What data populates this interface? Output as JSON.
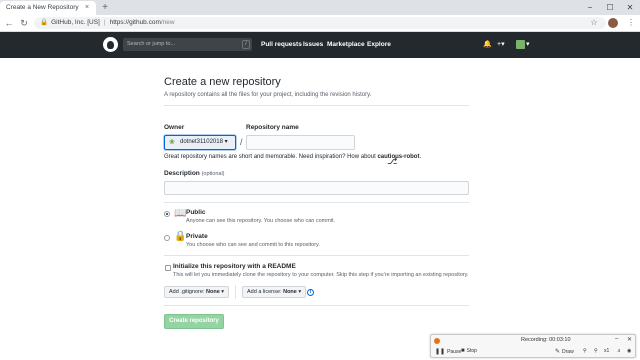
{
  "browser": {
    "tab_title": "Create a New Repository",
    "tab_close": "×",
    "new_tab": "+",
    "window_controls": {
      "minimize": "−",
      "maximize": "☐",
      "close": "✕"
    },
    "site_identity": "GitHub, Inc. [US]",
    "url_host": "https://github.com",
    "url_path": "/new"
  },
  "github_header": {
    "search_placeholder": "Search or jump to...",
    "search_key": "/",
    "nav": [
      "Pull requests",
      "Issues",
      "Marketplace",
      "Explore"
    ],
    "icons": [
      "bell-icon",
      "plus-icon",
      "avatar"
    ]
  },
  "form": {
    "title": "Create a new repository",
    "subtitle": "A repository contains all the files for your project, including the revision history.",
    "owner_label": "Owner",
    "owner_value": "dotnet31102018",
    "repo_name_label": "Repository name",
    "repo_name_value": "",
    "slash": "/",
    "hint_prefix": "Great repository names are short and memorable. Need inspiration? How about ",
    "hint_suggestion": "cautious-robot",
    "hint_suffix": ".",
    "description_label": "Description",
    "description_optional": "(optional)",
    "description_value": "",
    "public_title": "Public",
    "public_desc": "Anyone can see this repository. You choose who can commit.",
    "private_title": "Private",
    "private_desc": "You choose who can see and commit to this repository.",
    "visibility_selected": "Public",
    "readme_title": "Initialize this repository with a README",
    "readme_desc": "This will let you immediately clone the repository to your computer. Skip this step if you’re importing an existing repository.",
    "readme_checked": false,
    "gitignore_label": "Add .gitignore:",
    "gitignore_value": "None",
    "license_label": "Add a license:",
    "license_value": "None",
    "info_glyph": "i",
    "create_button": "Create repository"
  },
  "recorder": {
    "status_label": "Recording: 00:03:10",
    "buttons": [
      "Pause",
      "Stop",
      "Draw"
    ],
    "zoom_label": "x1"
  },
  "colors": {
    "github_header": "#24292e",
    "create_button_disabled": "#94d3a2",
    "link_blue": "#0366d6",
    "recording_orange": "#e8711a"
  }
}
